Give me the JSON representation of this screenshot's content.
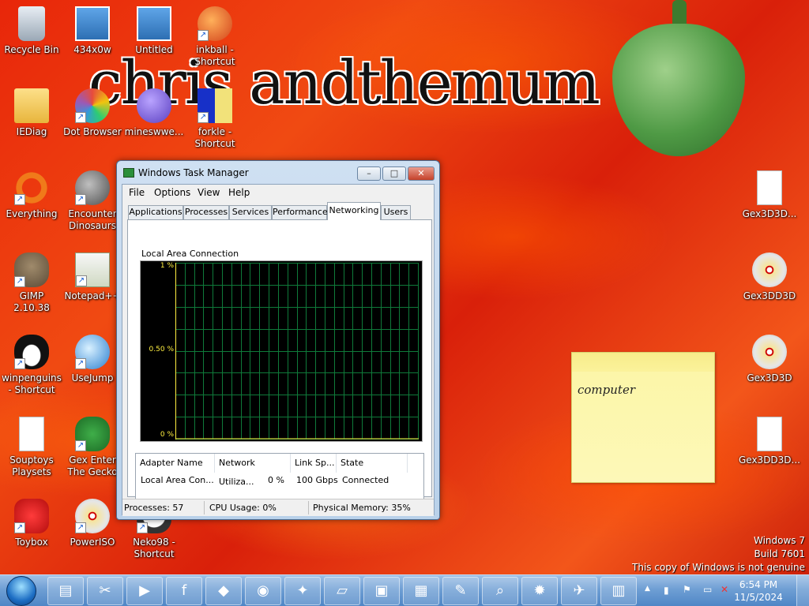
{
  "wallpaper": {
    "text": "chris andthemum"
  },
  "desktop_icons": [
    {
      "label": "Recycle Bin",
      "icon": "recycle-bin-icon",
      "shortcut": false
    },
    {
      "label": "434x0w",
      "icon": "image-file-icon",
      "shortcut": false
    },
    {
      "label": "Untitled",
      "icon": "image-file-icon",
      "shortcut": false
    },
    {
      "label": "inkball - Shortcut",
      "icon": "inkball-icon",
      "shortcut": true
    },
    {
      "label": "IEDiag",
      "icon": "folder-icon",
      "shortcut": false
    },
    {
      "label": "Dot Browser",
      "icon": "dot-browser-icon",
      "shortcut": true
    },
    {
      "label": "mineswwe...",
      "icon": "mine-icon",
      "shortcut": false
    },
    {
      "label": "forkle - Shortcut",
      "icon": "forkle-icon",
      "shortcut": true
    },
    {
      "label": "Everything",
      "icon": "everything-icon",
      "shortcut": true
    },
    {
      "label": "Encounter Dinosaurs",
      "icon": "dinosaur-icon",
      "shortcut": true
    },
    {
      "label": "GIMP 2.10.38",
      "icon": "gimp-icon",
      "shortcut": true
    },
    {
      "label": "Notepad++",
      "icon": "notepad-plus-icon",
      "shortcut": true
    },
    {
      "label": "winpenguins - Shortcut",
      "icon": "penguin-icon",
      "shortcut": true
    },
    {
      "label": "UseJump",
      "icon": "usejump-icon",
      "shortcut": true
    },
    {
      "label": "Souptoys Playsets",
      "icon": "document-icon",
      "shortcut": false
    },
    {
      "label": "Gex Enter The Gecko",
      "icon": "gecko-icon",
      "shortcut": true
    },
    {
      "label": "Toybox",
      "icon": "toybox-icon",
      "shortcut": true
    },
    {
      "label": "PowerISO",
      "icon": "disc-icon",
      "shortcut": true
    },
    {
      "label": "Neko98 - Shortcut",
      "icon": "neko-icon",
      "shortcut": true
    },
    {
      "label": "Gex3D3D...",
      "icon": "document-icon",
      "shortcut": false
    },
    {
      "label": "Gex3DD3D",
      "icon": "disc-icon",
      "shortcut": false
    },
    {
      "label": "Gex3D3D",
      "icon": "disc-icon",
      "shortcut": false
    },
    {
      "label": "Gex3DD3D...",
      "icon": "document-icon",
      "shortcut": false
    }
  ],
  "task_manager": {
    "title": "Windows Task Manager",
    "caption_buttons": {
      "minimize": "–",
      "maximize": "□",
      "close": "✕"
    },
    "menu": [
      "File",
      "Options",
      "View",
      "Help"
    ],
    "tabs": [
      "Applications",
      "Processes",
      "Services",
      "Performance",
      "Networking",
      "Users"
    ],
    "active_tab": "Networking",
    "graph": {
      "label": "Local Area Connection",
      "y_labels": [
        "1 %",
        "0.50 %",
        "0 %"
      ],
      "line_color": "#ffef40",
      "grid_color": "#0f7a3a"
    },
    "table": {
      "columns": [
        "Adapter Name",
        "Network Utiliza...",
        "Link Sp...",
        "State"
      ],
      "rows": [
        [
          "Local Area Con...",
          "0 %",
          "100 Gbps",
          "Connected"
        ]
      ]
    },
    "status": {
      "processes": "Processes: 57",
      "cpu": "CPU Usage: 0%",
      "memory": "Physical Memory: 35%"
    }
  },
  "sticky_note": {
    "text": "computer"
  },
  "watermark": {
    "line1": "Windows 7",
    "line2": "Build 7601",
    "line3": "This copy of Windows is not genuine"
  },
  "taskbar": {
    "pinned": [
      {
        "icon": "explorer-icon",
        "glyph": "▤"
      },
      {
        "icon": "snipping-tool-icon",
        "glyph": "✂"
      },
      {
        "icon": "media-player-icon",
        "glyph": "▶"
      },
      {
        "icon": "facebook-icon",
        "glyph": "f"
      },
      {
        "icon": "app-icon",
        "glyph": "◆"
      },
      {
        "icon": "dot-browser-icon",
        "glyph": "◉"
      },
      {
        "icon": "usejump-icon",
        "glyph": "✦"
      },
      {
        "icon": "sticky-notes-icon",
        "glyph": "▱"
      },
      {
        "icon": "remote-desktop-icon",
        "glyph": "▣"
      },
      {
        "icon": "calculator-icon",
        "glyph": "▦"
      },
      {
        "icon": "paint-icon",
        "glyph": "✎"
      },
      {
        "icon": "search-icon",
        "glyph": "⌕"
      },
      {
        "icon": "mine-icon",
        "glyph": "✹"
      },
      {
        "icon": "bird-icon",
        "glyph": "✈"
      },
      {
        "icon": "task-manager-icon",
        "glyph": "▥"
      }
    ],
    "tray": {
      "chevron": "▲",
      "flag": "⚑",
      "network": "▮",
      "volume": "✕"
    },
    "clock": {
      "time": "6:54 PM",
      "date": "11/5/2024"
    }
  }
}
